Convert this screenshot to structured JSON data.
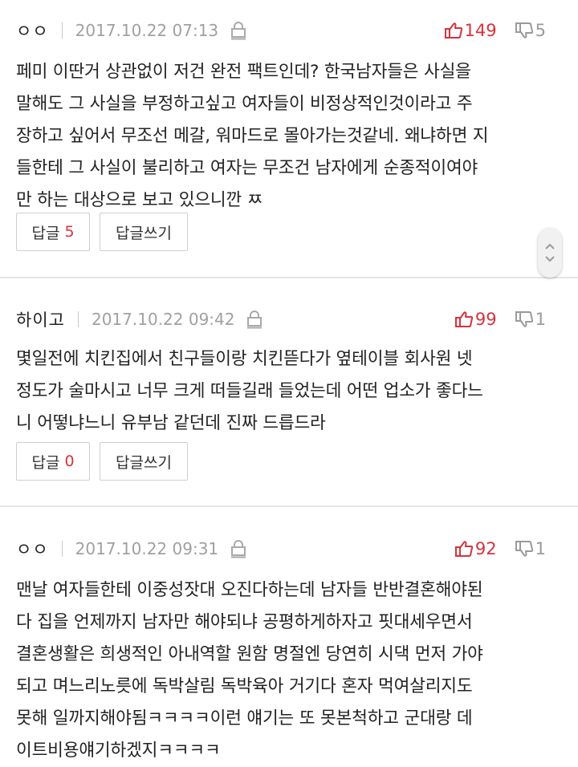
{
  "comments": [
    {
      "author": "ㅇㅇ",
      "date": "2017.10.22 07:13",
      "upvotes": "149",
      "downvotes": "5",
      "text": "페미 이딴거 상관없이 저건 완전 팩트인데? 한국남자들은 사실을\n말해도 그 사실을 부정하고싶고 여자들이 비정상적인것이라고 주\n장하고 싶어서 무조선 메갈, 워마드로 몰아가는것같네. 왜냐하면 지\n들한테 그 사실이 불리하고 여자는 무조건 남자에게 순종적이여야\n만 하는 대상으로 보고 있으니깐 ㅉ",
      "reply_label": "답글",
      "reply_count": "5",
      "write_reply_label": "답글쓰기"
    },
    {
      "author": "하이고",
      "date": "2017.10.22 09:42",
      "upvotes": "99",
      "downvotes": "1",
      "text": "몇일전에 치킨집에서 친구들이랑 치킨뜯다가 옆테이블 회사원 넷\n정도가 술마시고 너무 크게 떠들길래 들었는데 어떤 업소가 좋다느\n니 어떻냐느니 유부남 같던데 진짜 드릅드라",
      "reply_label": "답글",
      "reply_count": "0",
      "write_reply_label": "답글쓰기"
    },
    {
      "author": "ㅇㅇ",
      "date": "2017.10.22 09:31",
      "upvotes": "92",
      "downvotes": "1",
      "text": "맨날 여자들한테 이중성잣대 오진다하는데 남자들 반반결혼해야된\n다 집을 언제까지 남자만 해야되냐 공평하게하자고 핏대세우면서\n결혼생활은 희생적인 아내역할 원함 명절엔 당연히 시댁 먼저 가야\n되고 며느리노릇에 독박살림 독박육아 거기다 혼자 먹여살리지도\n못해 일까지해야됨ㅋㅋㅋㅋ이런 얘기는 또 못본척하고 군대랑 데\n이트비용얘기하겠지ㅋㅋㅋㅋ"
    }
  ],
  "colors": {
    "accent_red": "#d8323c",
    "muted_gray": "#a0a0a0",
    "divider": "#e4e4e4"
  },
  "icons": {
    "upvote": "thumbs-up-icon",
    "downvote": "thumbs-down-icon",
    "lock": "lock-icon",
    "scroll_up": "chevron-up-icon",
    "scroll_down": "chevron-down-icon"
  }
}
